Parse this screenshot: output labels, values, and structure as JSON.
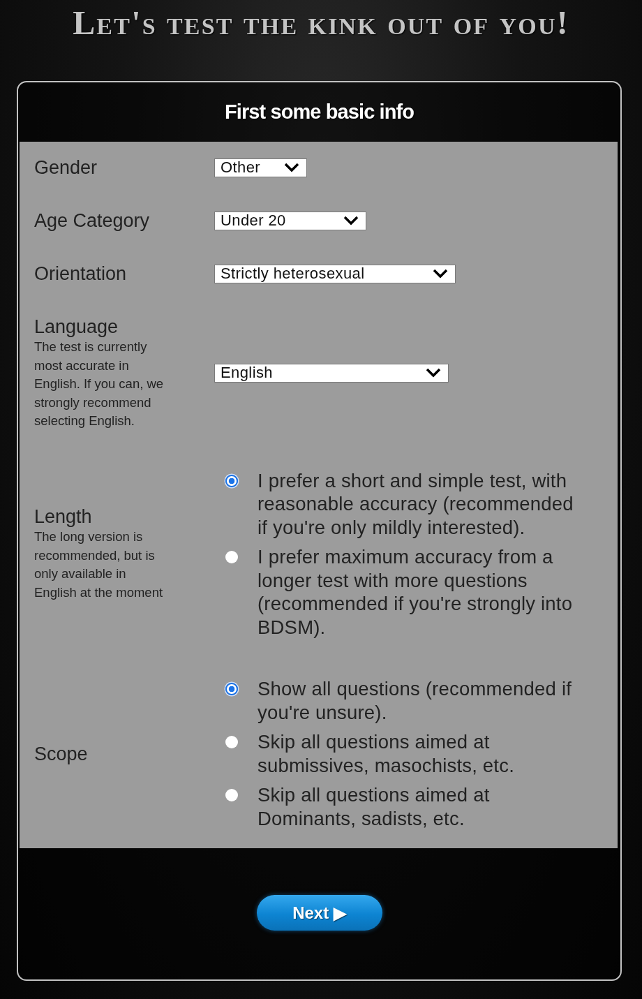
{
  "title": "Let's test the kink out of you!",
  "form": {
    "heading": "First some basic info",
    "fields": [
      {
        "kind": "select",
        "label": "Gender",
        "value": "Other"
      },
      {
        "kind": "select",
        "label": "Age Category",
        "value": "Under 20"
      },
      {
        "kind": "select",
        "label": "Orientation",
        "value": "Strictly heterosexual"
      },
      {
        "kind": "select",
        "label": "Language",
        "note": "The test is currently most accurate in English. If you can, we strongly recommend selecting English.",
        "value": "English"
      },
      {
        "kind": "radio",
        "label": "Length",
        "note": "The long version is recommended, but is only available in English at the moment",
        "options": [
          {
            "text": "I prefer a short and simple test, with reasonable accuracy (recommended if you're only mildly interested).",
            "selected": true
          },
          {
            "text": "I prefer maximum accuracy from a longer test with more questions (recommended if you're strongly into BDSM).",
            "selected": false
          }
        ]
      },
      {
        "kind": "radio",
        "label": "Scope",
        "options": [
          {
            "text": "Show all questions (recommended if you're unsure).",
            "selected": true
          },
          {
            "text": "Skip all questions aimed at submissives, masochists, etc.",
            "selected": false
          },
          {
            "text": "Skip all questions aimed at Dominants, sadists, etc.",
            "selected": false
          }
        ]
      }
    ]
  },
  "next_button": {
    "label": "Next ▶"
  }
}
